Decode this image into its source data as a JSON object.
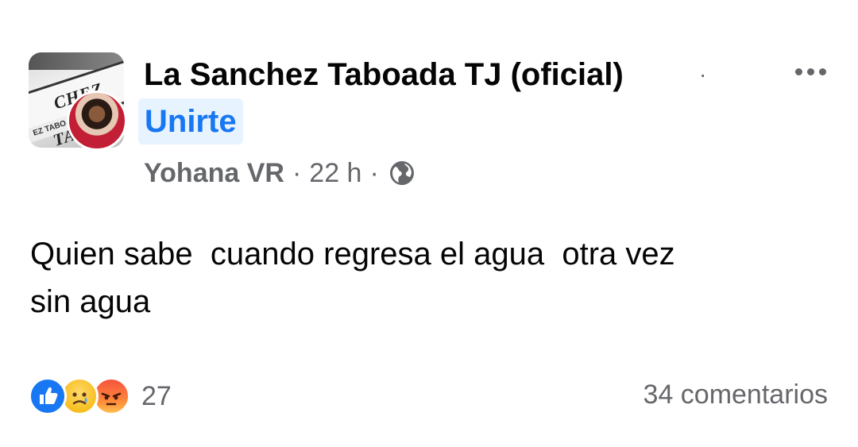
{
  "post": {
    "group_name": "La Sanchez Taboada TJ (oficial)",
    "separator": "·",
    "join_label": "Unirte",
    "author": "Yohana VR",
    "time": "22 h",
    "audience_icon": "globe-icon",
    "more_icon": "more-options-icon",
    "avatar_sign_text": "CHEZ TABOAD",
    "avatar_small_sign_text": "EZ TABOADA",
    "text": "Quien sabe  cuando regresa el agua  otra vez\nsin agua"
  },
  "footer": {
    "reactions": [
      "like-icon",
      "sad-icon",
      "angry-icon"
    ],
    "reaction_count": "27",
    "comments": "34 comentarios"
  },
  "colors": {
    "accent": "#1877f2",
    "join_bg": "#e7f3ff",
    "secondary_text": "#65676b",
    "primary_text": "#050505"
  }
}
